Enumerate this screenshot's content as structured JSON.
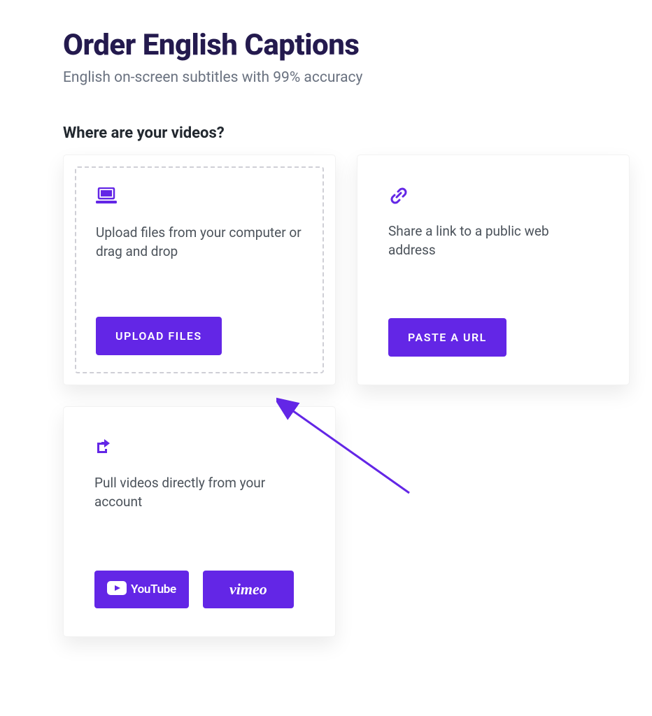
{
  "page": {
    "title": "Order English Captions",
    "subtitle": "English on-screen subtitles with 99% accuracy"
  },
  "section": {
    "heading": "Where are your videos?"
  },
  "cards": {
    "upload": {
      "description": "Upload files from your computer or drag and drop",
      "button_label": "Upload Files"
    },
    "url": {
      "description": "Share a link to a public web address",
      "button_label": "Paste a URL"
    },
    "account": {
      "description": "Pull videos directly from your account",
      "youtube_label": "YouTube",
      "vimeo_label": "vimeo"
    }
  },
  "colors": {
    "accent": "#6326e6",
    "heading": "#241a4e"
  }
}
